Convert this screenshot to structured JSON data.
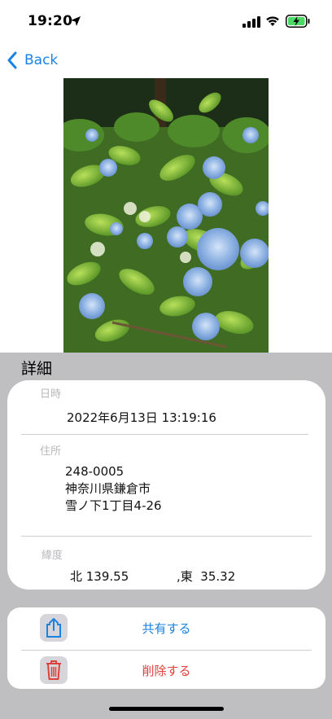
{
  "status_bar": {
    "time": "19:20"
  },
  "nav": {
    "back_label": "Back"
  },
  "details": {
    "title": "詳細",
    "datetime_label": "日時",
    "datetime_value": "2022年6月13日 13:19:16",
    "address_label": "住所",
    "address_lines": [
      "248-0005",
      "神奈川県鎌倉市",
      "雪ノ下1丁目4-26"
    ],
    "latlon_label": "緯度",
    "latitude_text": "北 139.55",
    "longitude_text": ",東  35.32"
  },
  "actions": {
    "share_label": "共有する",
    "delete_label": "削除する"
  },
  "colors": {
    "accent": "#1a82e2",
    "destructive": "#e0403a",
    "sheet_bg": "#bfbfc2"
  }
}
